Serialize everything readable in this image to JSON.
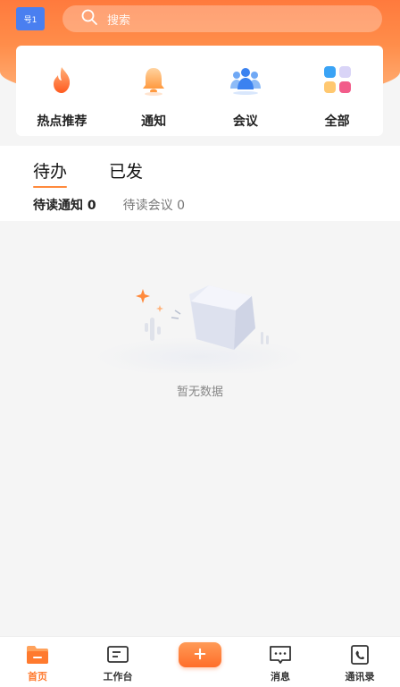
{
  "header": {
    "badge_text": "号1",
    "search_placeholder": "搜索",
    "colors": {
      "accent": "#ff7a3d"
    }
  },
  "quick_actions": [
    {
      "label": "热点推荐",
      "icon": "flame-icon"
    },
    {
      "label": "通知",
      "icon": "bell-icon"
    },
    {
      "label": "会议",
      "icon": "people-icon"
    },
    {
      "label": "全部",
      "icon": "grid-icon"
    }
  ],
  "tabs": [
    {
      "label": "待办",
      "active": true
    },
    {
      "label": "已发",
      "active": false
    }
  ],
  "sub_tabs": [
    {
      "label": "待读通知",
      "count": "0",
      "active": true
    },
    {
      "label": "待读会议",
      "count": "0",
      "active": false
    }
  ],
  "empty_state": {
    "text": "暂无数据"
  },
  "bottom_nav": [
    {
      "label": "首页",
      "icon": "folder-home-icon",
      "active": true
    },
    {
      "label": "工作台",
      "icon": "workbench-icon",
      "active": false
    },
    {
      "label": "消息",
      "icon": "message-icon",
      "active": false
    },
    {
      "label": "通讯录",
      "icon": "contacts-icon",
      "active": false
    }
  ],
  "add_button": {
    "icon": "plus-icon"
  }
}
